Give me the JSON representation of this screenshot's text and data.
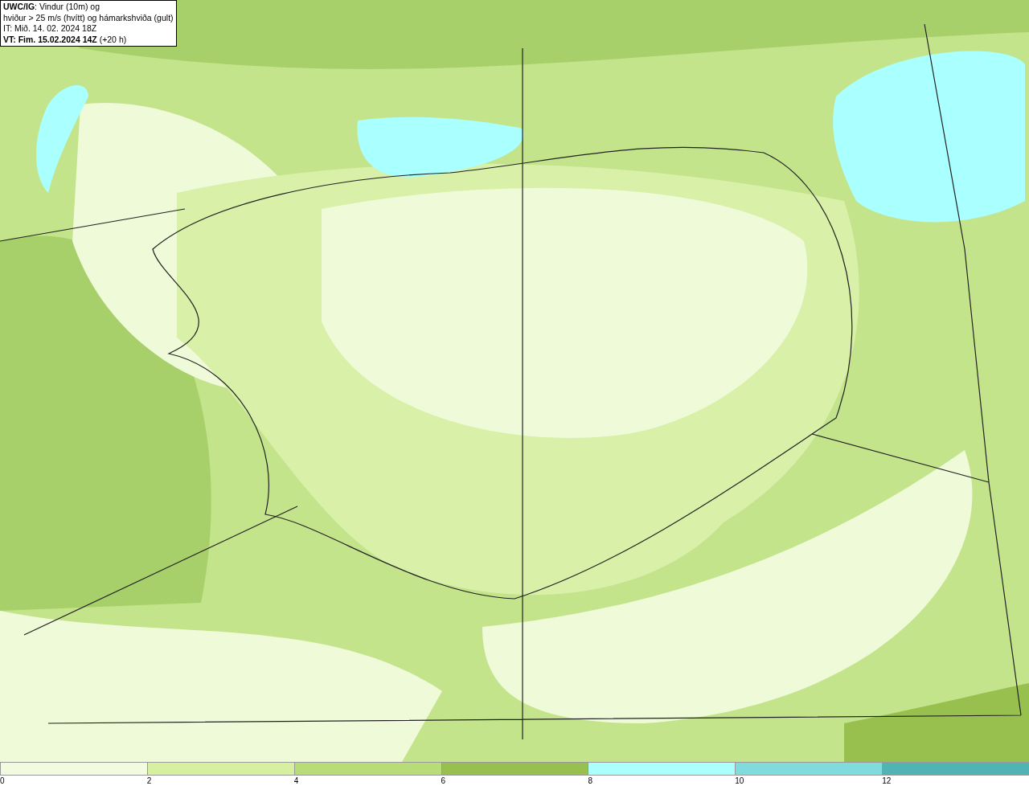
{
  "title_box": {
    "lines": [
      "**UWC/IG**: Vindur (10m) og",
      "hviður > 25 m/s (hvítt) og hámarkshviða (gult)",
      "IT: Mið. 14. 02. 2024 18Z",
      "**VT: Fim. 15.02.2024 14Z** (+20 h)"
    ]
  },
  "legend": {
    "bins": [
      {
        "color": "#f2fbdf"
      },
      {
        "color": "#d6f0a0"
      },
      {
        "color": "#b8dc78"
      },
      {
        "color": "#98c04e"
      },
      {
        "color": "#aaffff"
      },
      {
        "color": "#80dcdc"
      },
      {
        "color": "#50b4b4"
      }
    ],
    "ticks": [
      "0",
      "2",
      "4",
      "6",
      "8",
      "10",
      "12"
    ]
  }
}
